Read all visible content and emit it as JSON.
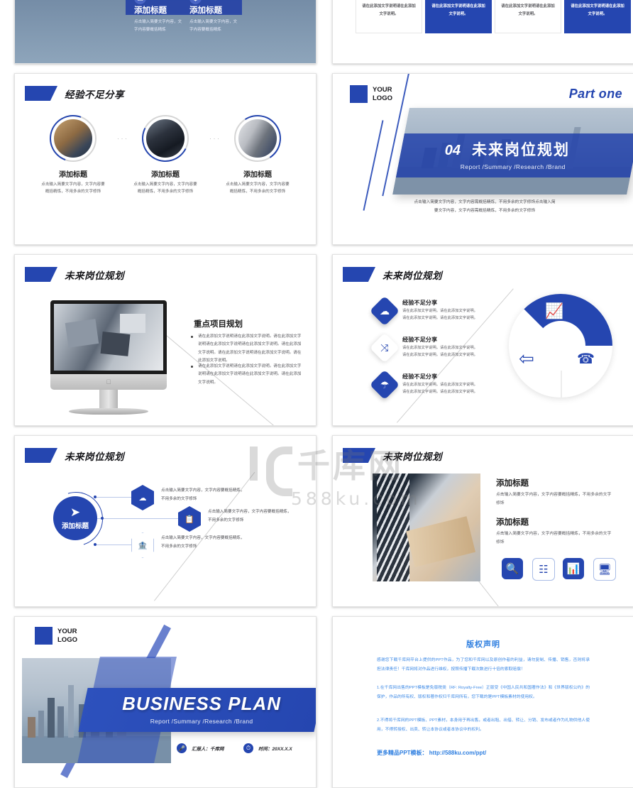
{
  "theme": {
    "accent_blue": "#2546B0",
    "link_blue": "#2f7fe0",
    "ring_grey": "#d6d6d6",
    "text_dark": "#1c1c1c",
    "text_body": "#56565b"
  },
  "watermark": {
    "logo": "千库网",
    "sub": "588ku.com"
  },
  "slides": [
    {
      "id": "slide-top-left",
      "cards": [
        {
          "title": "添加标题",
          "body": "点击输入简要文字内容，文字内容要概括精炼",
          "icon": "monitor-icon"
        },
        {
          "title": "添加标题",
          "body": "点击输入简要文字内容，文字内容要概括精炼",
          "icon": "dollar-icon"
        }
      ]
    },
    {
      "id": "slide-top-right",
      "cards": [
        {
          "text": "请在此添加文字说明请在此添加文字说明。",
          "style": "light"
        },
        {
          "text": "请在此添加文字说明请在此添加文字说明。",
          "style": "blue"
        },
        {
          "text": "请在此添加文字说明请在此添加文字说明。",
          "style": "light"
        },
        {
          "text": "请在此添加文字说明请在此添加文字说明。",
          "style": "blue"
        }
      ]
    },
    {
      "id": "slide-experience-circles",
      "title": "经验不足分享",
      "items": [
        {
          "heading": "添加标题",
          "body": "点击输入简要文字内容，文字内容要概括精炼，不用多余的文字修饰"
        },
        {
          "heading": "添加标题",
          "body": "点击输入简要文字内容，文字内容要概括精炼，不用多余的文字修饰"
        },
        {
          "heading": "添加标题",
          "body": "点击输入简要文字内容，文字内容要概括精炼，不用多余的文字修饰"
        }
      ],
      "separator": "···"
    },
    {
      "id": "slide-part-one",
      "logo_line1": "YOUR",
      "logo_line2": "LOGO",
      "part_label": "Part one",
      "number": "04",
      "banner_title": "未来岗位规划",
      "banner_subtitle": "Report /Summary /Research /Brand",
      "description_line1": "点击输入简要文字内容，文字内容需概括精炼，不用多余的文字修饰点击输入简",
      "description_line2": "要文字内容，文字内容需概括精炼，不用多余的文字修饰"
    },
    {
      "id": "slide-imac",
      "title": "未来岗位规划",
      "heading": "重点项目规划",
      "bullets": [
        "请在此添加文字说明请在此添加文字说明。请在此添加文字说明请在此添加文字说明请在此添加文字说明。请在此添加文字说明。请在此添加文字说明请在此添加文字说明。请在此添加文字说明。",
        "请在此添加文字说明请在此添加文字说明。请在此添加文字说明请在此添加文字说明请在此添加文字说明。请在此添加文字说明。"
      ]
    },
    {
      "id": "slide-donut",
      "title": "未来岗位规划",
      "items": [
        {
          "heading": "经验不足分享",
          "body_line1": "请在此添加文字说明。请在此添加文字说明。",
          "body_line2": "请在此添加文字说明。请在此添加文字说明。",
          "icon": "cloud-download-icon",
          "style": "fill"
        },
        {
          "heading": "经验不足分享",
          "body_line1": "请在此添加文字说明。请在此添加文字说明。",
          "body_line2": "请在此添加文字说明。请在此添加文字说明。",
          "icon": "shuffle-icon",
          "style": "ghost"
        },
        {
          "heading": "经验不足分享",
          "body_line1": "请在此添加文字说明。请在此添加文字说明。",
          "body_line2": "请在此添加文字说明。请在此添加文字说明。",
          "icon": "umbrella-icon",
          "style": "fill"
        }
      ],
      "donut_segments": [
        {
          "icon": "bar-chart-growth-icon",
          "style": "fill"
        },
        {
          "icon": "phone-icon",
          "style": "outline"
        },
        {
          "icon": "arrow-circle-left-icon",
          "style": "outline"
        }
      ]
    },
    {
      "id": "slide-hexagons",
      "title": "未来岗位规划",
      "center_label": "添加标题",
      "center_icon": "paper-plane-icon",
      "items": [
        {
          "icon": "cloud-icon",
          "style": "fill",
          "line1": "点击输入简要文字内容，文字内容要概括精炼，",
          "line2": "不用多余的文字修饰"
        },
        {
          "icon": "document-icon",
          "style": "fill",
          "line1": "点击输入简要文字内容，文字内容要概括精炼，",
          "line2": "不用多余的文字修饰"
        },
        {
          "icon": "bank-icon",
          "style": "outline",
          "line1": "点击输入简要文字内容，文字内容要概括精炼，",
          "line2": "不用多余的文字修饰"
        }
      ]
    },
    {
      "id": "slide-photo-text",
      "title": "未来岗位规划",
      "blocks": [
        {
          "heading": "添加标题",
          "body": "点击输入简要文字内容，文字内容要概括精炼，不用多余的文字修饰"
        },
        {
          "heading": "添加标题",
          "body": "点击输入简要文字内容，文字内容要概括精炼，不用多余的文字修饰"
        }
      ],
      "icons": [
        {
          "name": "report-search-icon",
          "style": "fill"
        },
        {
          "name": "org-chart-icon",
          "style": "out"
        },
        {
          "name": "presentation-icon",
          "style": "fill"
        },
        {
          "name": "server-screen-icon",
          "style": "out"
        }
      ]
    },
    {
      "id": "slide-cover",
      "logo_line1": "YOUR",
      "logo_line2": "LOGO",
      "title": "BUSINESS PLAN",
      "subtitle": "Report /Summary /Research /Brand",
      "presenter": "汇报人：千库网",
      "date": "时间：20XX.X.X",
      "presenter_icon": "mic-icon",
      "date_icon": "clock-icon"
    },
    {
      "id": "slide-copyright",
      "heading": "版权声明",
      "paragraph_1": "感谢您下载千库网平台上提供的PPT作品，为了您和千库网以及原创作者的利益，请勿复制、传播、销售，否则将承担法律责任！千库网将对作品进行维权，按照传播下载次数进行十倍的索取赔偿！",
      "paragraph_2": "1.在千库网出售的PPT模板是免版税类（RF: Royalty-Free）正版受《中国人民共和国著作法》和《世界版权公约》的保护，作品的所有权、版权和著作权归千库网所有，您下载的是PPT模板素材的使用权。",
      "paragraph_3": "2.不得将千库网的PPT模板、PPT素材，本身用于再出售，或者出租、出借、转让、分销、发布或者作为礼物供他人使用，不得转授权、出卖、转让本协议或者本协议中的权利。",
      "link_label": "更多精品PPT模板：",
      "link_url": "http://588ku.com/ppt/"
    }
  ]
}
